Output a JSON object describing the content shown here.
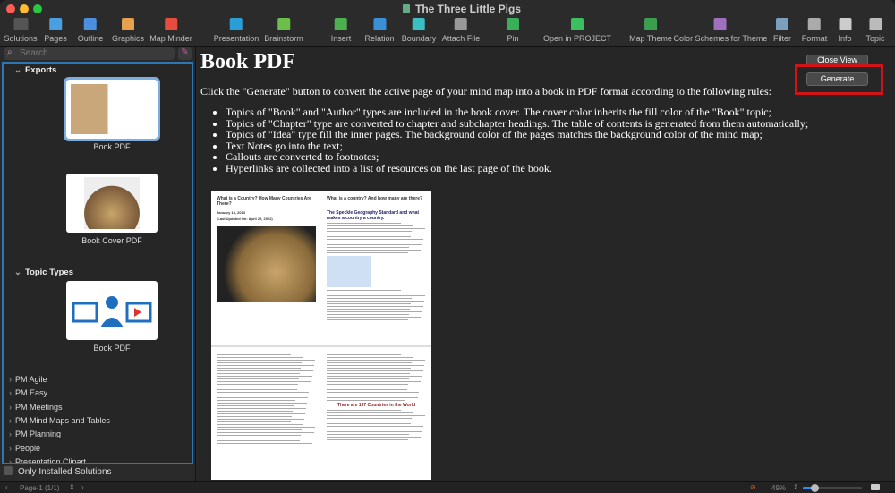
{
  "window": {
    "title": "The Three Little Pigs"
  },
  "toolbar": [
    {
      "label": "Solutions",
      "icon": "solutions-icon"
    },
    {
      "label": "Pages",
      "icon": "pages-icon"
    },
    {
      "label": "Outline",
      "icon": "outline-icon"
    },
    {
      "label": "Graphics",
      "icon": "graphics-icon"
    },
    {
      "label": "Map Minder",
      "icon": "map-minder-icon"
    },
    {
      "label": "Presentation",
      "icon": "presentation-icon"
    },
    {
      "label": "Brainstorm",
      "icon": "brainstorm-icon"
    },
    {
      "label": "Insert",
      "icon": "insert-icon"
    },
    {
      "label": "Relation",
      "icon": "relation-icon"
    },
    {
      "label": "Boundary",
      "icon": "boundary-icon"
    },
    {
      "label": "Attach File",
      "icon": "paperclip-icon"
    },
    {
      "label": "Pin",
      "icon": "pin-icon"
    },
    {
      "label": "Open in PROJECT",
      "icon": "project-icon"
    },
    {
      "label": "Map Theme",
      "icon": "map-theme-icon"
    },
    {
      "label": "Color Schemes for Theme",
      "icon": "color-schemes-icon"
    },
    {
      "label": "Filter",
      "icon": "filter-icon"
    },
    {
      "label": "Format",
      "icon": "format-icon"
    },
    {
      "label": "Info",
      "icon": "info-icon"
    },
    {
      "label": "Topic",
      "icon": "topic-icon"
    }
  ],
  "sidebar": {
    "search_placeholder": "Search",
    "sections": {
      "exports": "Exports",
      "topic_types": "Topic Types"
    },
    "items": {
      "book_pdf": "Book PDF",
      "book_cover_pdf": "Book Cover PDF",
      "topic_book_pdf": "Book PDF"
    },
    "categories": [
      "PM Agile",
      "PM Easy",
      "PM Meetings",
      "PM Mind Maps and Tables",
      "PM Planning",
      "People",
      "Presentation Clipart"
    ],
    "only_installed": "Only Installed Solutions"
  },
  "status": {
    "page": "Page-1 (1/1)",
    "zoom": "49%",
    "zoom_fraction": 0.49
  },
  "main": {
    "title": "Book PDF",
    "intro": "Click the \"Generate\" button to convert the active page of your mind map into a book in PDF format according to the following rules:",
    "rules": [
      "Topics of \"Book\" and \"Author\" types are included in the book cover. The cover color inherits the fill color of the \"Book\" topic;",
      "Topics of \"Chapter\" type are converted to chapter and subchapter headings. The table of contents is generated from them automatically;",
      "Topics of \"Idea\" type fill the inner pages. The background color of the pages matches the background color of the mind map;",
      "Text Notes go into the text;",
      "Callouts are converted to footnotes;",
      "Hyperlinks are collected into a list of resources on the last page of the book."
    ],
    "close_view": "Close View",
    "generate": "Generate",
    "preview": {
      "page1_title": "What is a Country? How Many Countries Are There?",
      "page1_date": "January 14, 2013",
      "page1_updated": "(Last Updated On: April 22, 2022)",
      "page2_title": "What is a country? And how many are there?",
      "page2_sub": "The Speckle Geography Standard and what makes a country a country.",
      "page4_heading": "There are 197 Countries in the World"
    }
  }
}
